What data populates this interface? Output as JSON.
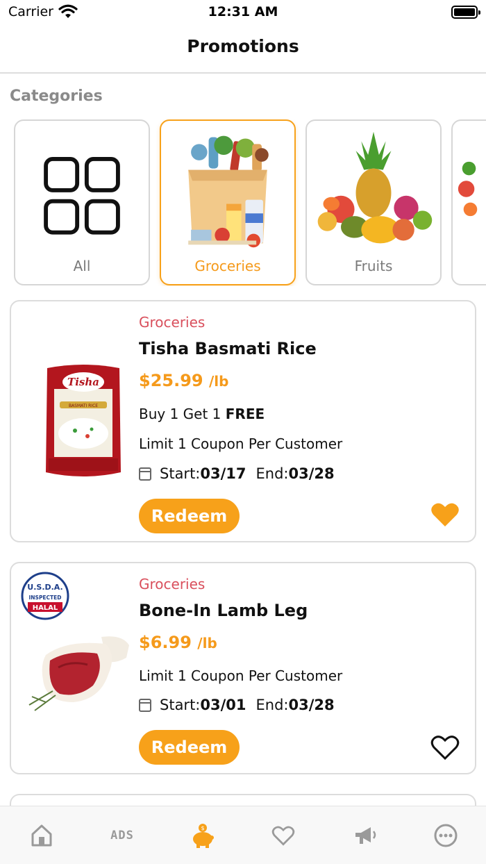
{
  "status_bar": {
    "carrier": "Carrier",
    "time": "12:31 AM"
  },
  "nav": {
    "title": "Promotions"
  },
  "categories_label": "Categories",
  "categories": [
    {
      "label": "All",
      "icon": "grid-icon",
      "active": false
    },
    {
      "label": "Groceries",
      "icon": "grocery-bag-image",
      "active": true
    },
    {
      "label": "Fruits",
      "icon": "fruits-image",
      "active": false
    }
  ],
  "promotions": [
    {
      "category": "Groceries",
      "name": "Tisha Basmati Rice",
      "price": "$25.99",
      "unit": "/lb",
      "offer_prefix": "Buy 1 Get 1",
      "offer_bold": "FREE",
      "limit": "Limit 1 Coupon Per Customer",
      "start_label": "Start:",
      "start": "03/17",
      "end_label": "End:",
      "end": "03/28",
      "button": "Redeem",
      "favorited": true,
      "image": "rice-bag-image",
      "bag_brand": "Tisha",
      "bag_text": "BASMATI RICE"
    },
    {
      "category": "Groceries",
      "name": "Bone-In Lamb Leg",
      "price": "$6.99",
      "unit": "/lb",
      "limit": "Limit 1 Coupon Per Customer",
      "start_label": "Start:",
      "start": "03/01",
      "end_label": "End:",
      "end": "03/28",
      "button": "Redeem",
      "favorited": false,
      "image": "lamb-leg-image",
      "badge": {
        "line1": "U.S.D.A.",
        "line2": "INSPECTED",
        "line3": "HALAL"
      }
    }
  ],
  "tab_bar": [
    {
      "name": "home-icon"
    },
    {
      "name": "ads-icon",
      "label": "ADS"
    },
    {
      "name": "piggy-bank-icon",
      "active": true
    },
    {
      "name": "heart-icon"
    },
    {
      "name": "megaphone-icon"
    },
    {
      "name": "more-icon"
    }
  ],
  "colors": {
    "accent": "#f7a11a",
    "category_text": "#d94f5c",
    "inactive": "#9a9a9a"
  }
}
